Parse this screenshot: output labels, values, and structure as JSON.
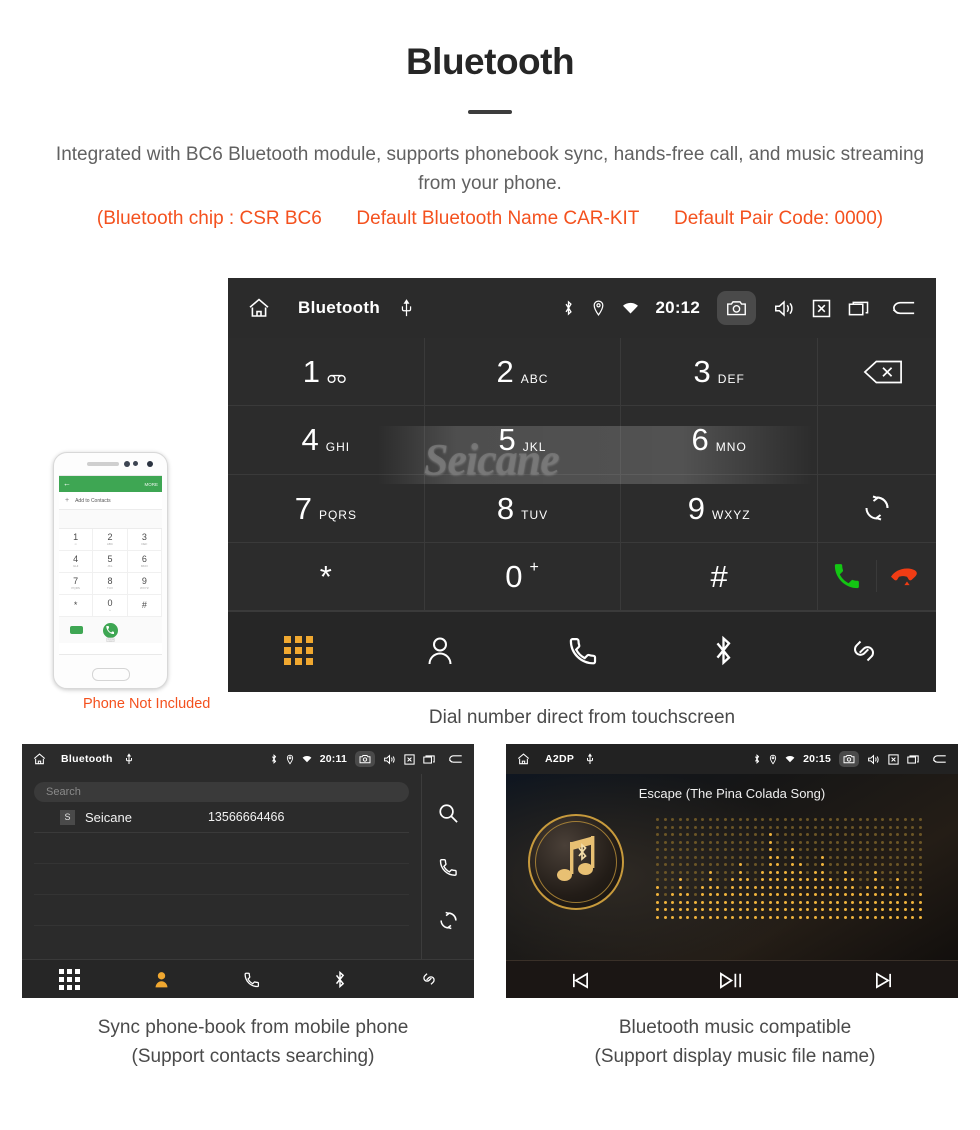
{
  "header": {
    "title": "Bluetooth",
    "intro": "Integrated with BC6 Bluetooth module, supports phonebook sync, hands-free call, and music streaming from your phone.",
    "spec_open": "(Bluetooth chip : CSR BC6",
    "spec_name": "Default Bluetooth Name CAR-KIT",
    "spec_code": "Default Pair Code: 0000)",
    "accent_color": "#f4511e"
  },
  "phone_mock": {
    "note": "Phone Not Included",
    "appbar_more": "MORE",
    "add_contacts": "Add to Contacts",
    "keys": [
      {
        "num": "1",
        "ltr": "∞"
      },
      {
        "num": "2",
        "ltr": "ABC"
      },
      {
        "num": "3",
        "ltr": "DEF"
      },
      {
        "num": "4",
        "ltr": "GHI"
      },
      {
        "num": "5",
        "ltr": "JKL"
      },
      {
        "num": "6",
        "ltr": "MNO"
      },
      {
        "num": "7",
        "ltr": "PQRS"
      },
      {
        "num": "8",
        "ltr": "TUV"
      },
      {
        "num": "9",
        "ltr": "WXYZ"
      },
      {
        "num": "*",
        "ltr": ""
      },
      {
        "num": "0",
        "ltr": "+"
      },
      {
        "num": "#",
        "ltr": ""
      }
    ]
  },
  "dialer": {
    "statusbar": {
      "title": "Bluetooth",
      "time": "20:12",
      "icons": [
        "home-icon",
        "usb-icon",
        "bluetooth-icon",
        "location-icon",
        "wifi-icon",
        "camera-icon",
        "volume-icon",
        "close-box-icon",
        "recents-icon",
        "back-icon"
      ]
    },
    "keys": [
      {
        "num": "1",
        "ltr": "",
        "sub": "voicemail-icon"
      },
      {
        "num": "2",
        "ltr": "ABC"
      },
      {
        "num": "3",
        "ltr": "DEF"
      },
      {
        "num": "4",
        "ltr": "GHI"
      },
      {
        "num": "5",
        "ltr": "JKL"
      },
      {
        "num": "6",
        "ltr": "MNO"
      },
      {
        "num": "7",
        "ltr": "PQRS"
      },
      {
        "num": "8",
        "ltr": "TUV"
      },
      {
        "num": "9",
        "ltr": "WXYZ"
      },
      {
        "num": "*",
        "ltr": ""
      },
      {
        "num": "0",
        "ltr": "+"
      },
      {
        "num": "#",
        "ltr": ""
      }
    ],
    "watermark": "Seicane",
    "right_panel": {
      "delete": "backspace-icon",
      "sync": "sync-icon",
      "call": "call-icon",
      "hangup": "hangup-icon",
      "call_color": "#13c613",
      "hangup_color": "#f03c14"
    },
    "navbar": [
      "dialpad-icon",
      "contacts-icon",
      "call-log-icon",
      "bluetooth-icon",
      "link-icon"
    ],
    "navbar_active": "dialpad-icon",
    "active_color": "#f0a830",
    "caption": "Dial number direct from touchscreen"
  },
  "phonebook": {
    "statusbar": {
      "title": "Bluetooth",
      "time": "20:11"
    },
    "search_placeholder": "Search",
    "contacts": [
      {
        "initial": "S",
        "name": "Seicane",
        "number": "13566664466"
      }
    ],
    "side_icons": [
      "search-icon",
      "call-icon",
      "sync-icon"
    ],
    "navbar": [
      "dialpad-icon",
      "contacts-icon",
      "call-log-icon",
      "bluetooth-icon",
      "link-icon"
    ],
    "navbar_active": "contacts-icon",
    "caption_line1": "Sync phone-book from mobile phone",
    "caption_line2": "(Support contacts searching)"
  },
  "music": {
    "statusbar": {
      "title": "A2DP",
      "time": "20:15"
    },
    "song_title": "Escape (The Pina Colada Song)",
    "controls": [
      "previous-icon",
      "play-pause-icon",
      "next-icon"
    ],
    "caption_line1": "Bluetooth music compatible",
    "caption_line2": "(Support display music file name)"
  }
}
